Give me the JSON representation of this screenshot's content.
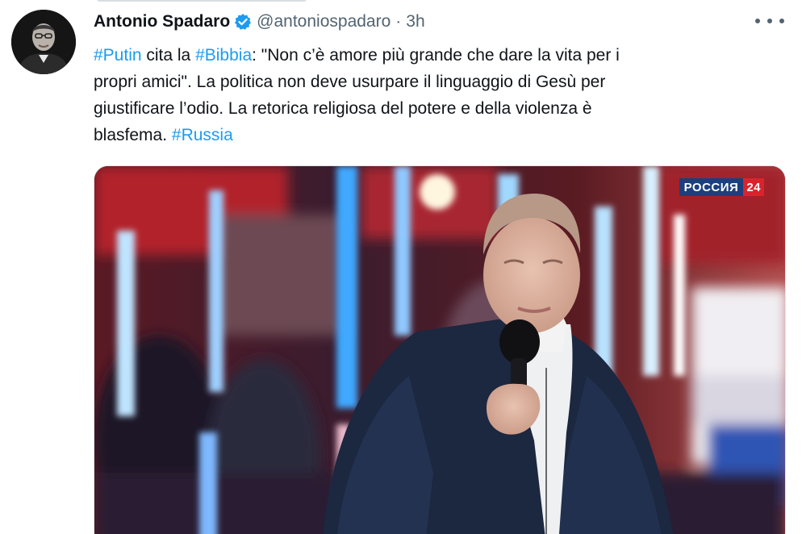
{
  "tweet": {
    "author": {
      "display_name": "Antonio Spadaro",
      "verified": true,
      "handle": "@antoniospadaro",
      "separator": "·",
      "time": "3h",
      "avatar_icon": "avatar-photo"
    },
    "text_lines": [
      [
        {
          "text": "#Putin",
          "type": "hashtag"
        },
        {
          "text": " cita la ",
          "type": "text"
        },
        {
          "text": "#Bibbia",
          "type": "hashtag"
        },
        {
          "text": ": \"Non c’è amore più grande che dare la vita per i",
          "type": "text"
        }
      ],
      [
        {
          "text": "propri amici\". La politica non deve usurpare il linguaggio di Gesù per",
          "type": "text"
        }
      ],
      [
        {
          "text": "giustificare l’odio. La retorica religiosa del potere e della violenza è",
          "type": "text"
        }
      ],
      [
        {
          "text": "blasfema. ",
          "type": "text"
        },
        {
          "text": "#Russia",
          "type": "hashtag"
        }
      ]
    ],
    "media": {
      "channel_name": "РОССИЯ",
      "channel_number": "24"
    },
    "more_icon": "more-horizontal-icon",
    "colors": {
      "hashtag": "#1d9bf0",
      "secondary_text": "#536471",
      "verified_badge": "#1d9bf0"
    }
  }
}
